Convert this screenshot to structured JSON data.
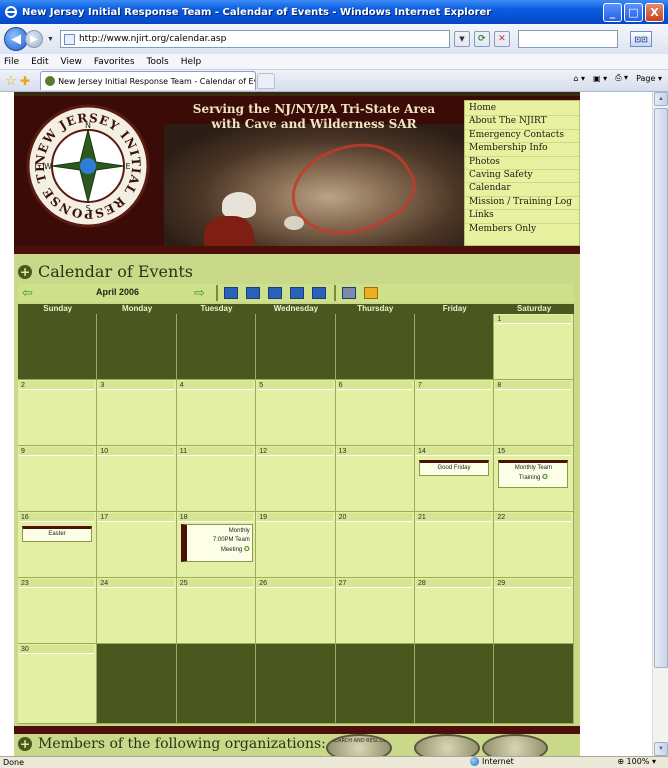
{
  "window": {
    "title": "New Jersey Initial Response Team - Calendar of Events - Windows Internet Explorer",
    "min_label": "_",
    "max_label": "□",
    "close_label": "X"
  },
  "browser": {
    "back_label": "◀",
    "forward_label": "▶",
    "url": "http://www.njirt.org/calendar.asp",
    "search_placeholder": "",
    "search_button": "⊡⊡",
    "menu": [
      "File",
      "Edit",
      "View",
      "Favorites",
      "Tools",
      "Help"
    ],
    "tab_title": "New Jersey Initial Response Team - Calendar of Events",
    "commands": [
      "⌂ ▾",
      "▣ ▾",
      "⎙ ▾",
      "Page ▾"
    ],
    "status_left": "Done",
    "status_zone": "Internet",
    "status_zoom": "⊕ 100% ▾"
  },
  "header": {
    "tagline_line1": "Serving the NJ/NY/PA Tri-State Area",
    "tagline_line2": "with Cave and Wilderness SAR",
    "logo_text": "NEW JERSEY INITIAL RESPONSE TEAM",
    "compass": {
      "n": "N",
      "s": "S",
      "e": "E",
      "w": "W"
    },
    "nav": [
      "Home",
      "About The NJIRT",
      "Emergency Contacts",
      "Membership Info",
      "Photos",
      "Caving Safety",
      "Calendar",
      "Mission / Training Log",
      "Links",
      "Members Only"
    ]
  },
  "calendar": {
    "title": "Calendar of Events",
    "month": "April 2006",
    "prev_label": "⇦",
    "next_label": "⇨",
    "days": [
      "Sunday",
      "Monday",
      "Tuesday",
      "Wednesday",
      "Thursday",
      "Friday",
      "Saturday"
    ],
    "weeks": [
      [
        "",
        "",
        "",
        "",
        "",
        "",
        "1"
      ],
      [
        "2",
        "3",
        "4",
        "5",
        "6",
        "7",
        "8"
      ],
      [
        "9",
        "10",
        "11",
        "12",
        "13",
        "14",
        "15"
      ],
      [
        "16",
        "17",
        "18",
        "19",
        "20",
        "21",
        "22"
      ],
      [
        "23",
        "24",
        "25",
        "26",
        "27",
        "28",
        "29"
      ],
      [
        "30",
        "",
        "",
        "",
        "",
        "",
        ""
      ]
    ],
    "events": {
      "good_friday": "Good Friday",
      "monthly_training_line1": "Monthly Team",
      "monthly_training_line2": "Training",
      "easter": "Easter",
      "meeting_line1": "Monthly",
      "meeting_line2": "7:00PM Team",
      "meeting_line3": "Meeting",
      "recur_icon": "✪"
    }
  },
  "footer": {
    "orgs_label": "Members of the following organizations:",
    "badge1": "SEARCH AND RESCUE",
    "badge2": "",
    "badge3": ""
  }
}
